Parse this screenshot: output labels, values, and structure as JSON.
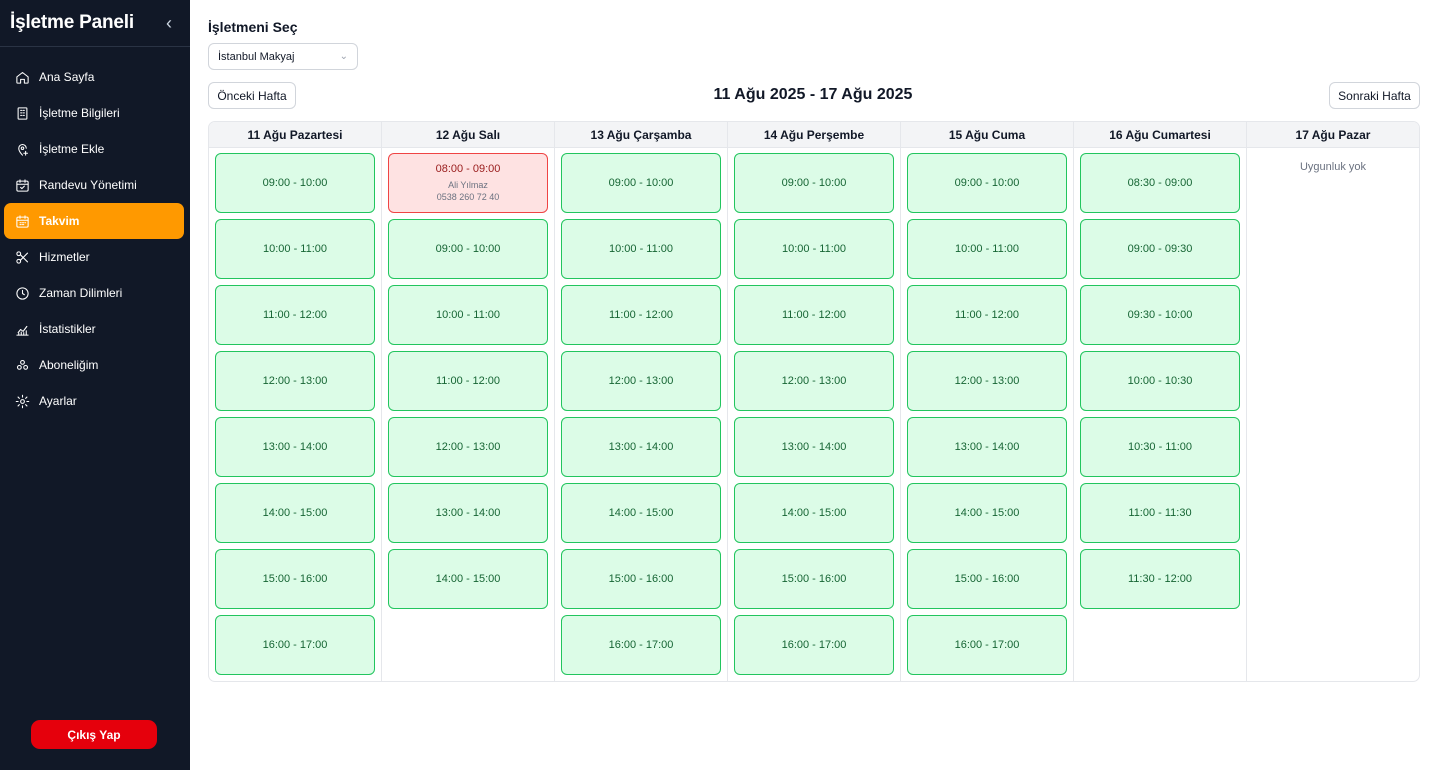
{
  "sidebar": {
    "title": "İşletme Paneli",
    "items": [
      {
        "label": "Ana Sayfa",
        "icon": "home-icon"
      },
      {
        "label": "İşletme Bilgileri",
        "icon": "building-icon"
      },
      {
        "label": "İşletme Ekle",
        "icon": "location-add-icon"
      },
      {
        "label": "Randevu Yönetimi",
        "icon": "calendar-check-icon"
      },
      {
        "label": "Takvim",
        "icon": "calendar-icon"
      },
      {
        "label": "Hizmetler",
        "icon": "scissors-icon"
      },
      {
        "label": "Zaman Dilimleri",
        "icon": "clock-icon"
      },
      {
        "label": "İstatistikler",
        "icon": "chart-icon"
      },
      {
        "label": "Aboneliğim",
        "icon": "subscription-icon"
      },
      {
        "label": "Ayarlar",
        "icon": "gear-icon"
      }
    ],
    "active_index": 4,
    "logout_label": "Çıkış Yap"
  },
  "business": {
    "label": "İşletmeni Seç",
    "selected": "İstanbul Makyaj"
  },
  "week": {
    "prev_label": "Önceki Hafta",
    "next_label": "Sonraki Hafta",
    "range": "11 Ağu 2025 - 17 Ağu 2025"
  },
  "colors": {
    "accent": "#ff9900",
    "sidebar_bg": "#111827",
    "available_bg": "#dcfce7",
    "available_border": "#22c55e",
    "booked_bg": "#fee2e2",
    "booked_border": "#ef4444",
    "logout": "#e5000c"
  },
  "days": [
    {
      "title": "11 Ağu Pazartesi",
      "slots": [
        {
          "time": "09:00 - 10:00"
        },
        {
          "time": "10:00 - 11:00"
        },
        {
          "time": "11:00 - 12:00"
        },
        {
          "time": "12:00 - 13:00"
        },
        {
          "time": "13:00 - 14:00"
        },
        {
          "time": "14:00 - 15:00"
        },
        {
          "time": "15:00 - 16:00"
        },
        {
          "time": "16:00 - 17:00"
        }
      ]
    },
    {
      "title": "12 Ağu Salı",
      "slots": [
        {
          "time": "08:00 - 09:00",
          "booked": true,
          "customer": "Ali Yılmaz",
          "phone": "0538 260 72 40"
        },
        {
          "time": "09:00 - 10:00"
        },
        {
          "time": "10:00 - 11:00"
        },
        {
          "time": "11:00 - 12:00"
        },
        {
          "time": "12:00 - 13:00"
        },
        {
          "time": "13:00 - 14:00"
        },
        {
          "time": "14:00 - 15:00"
        }
      ]
    },
    {
      "title": "13 Ağu Çarşamba",
      "slots": [
        {
          "time": "09:00 - 10:00"
        },
        {
          "time": "10:00 - 11:00"
        },
        {
          "time": "11:00 - 12:00"
        },
        {
          "time": "12:00 - 13:00"
        },
        {
          "time": "13:00 - 14:00"
        },
        {
          "time": "14:00 - 15:00"
        },
        {
          "time": "15:00 - 16:00"
        },
        {
          "time": "16:00 - 17:00"
        }
      ]
    },
    {
      "title": "14 Ağu Perşembe",
      "slots": [
        {
          "time": "09:00 - 10:00"
        },
        {
          "time": "10:00 - 11:00"
        },
        {
          "time": "11:00 - 12:00"
        },
        {
          "time": "12:00 - 13:00"
        },
        {
          "time": "13:00 - 14:00"
        },
        {
          "time": "14:00 - 15:00"
        },
        {
          "time": "15:00 - 16:00"
        },
        {
          "time": "16:00 - 17:00"
        }
      ]
    },
    {
      "title": "15 Ağu Cuma",
      "slots": [
        {
          "time": "09:00 - 10:00"
        },
        {
          "time": "10:00 - 11:00"
        },
        {
          "time": "11:00 - 12:00"
        },
        {
          "time": "12:00 - 13:00"
        },
        {
          "time": "13:00 - 14:00"
        },
        {
          "time": "14:00 - 15:00"
        },
        {
          "time": "15:00 - 16:00"
        },
        {
          "time": "16:00 - 17:00"
        }
      ]
    },
    {
      "title": "16 Ağu Cumartesi",
      "slots": [
        {
          "time": "08:30 - 09:00"
        },
        {
          "time": "09:00 - 09:30"
        },
        {
          "time": "09:30 - 10:00"
        },
        {
          "time": "10:00 - 10:30"
        },
        {
          "time": "10:30 - 11:00"
        },
        {
          "time": "11:00 - 11:30"
        },
        {
          "time": "11:30 - 12:00"
        }
      ]
    },
    {
      "title": "17 Ağu Pazar",
      "slots": [],
      "empty_text": "Uygunluk yok"
    }
  ]
}
